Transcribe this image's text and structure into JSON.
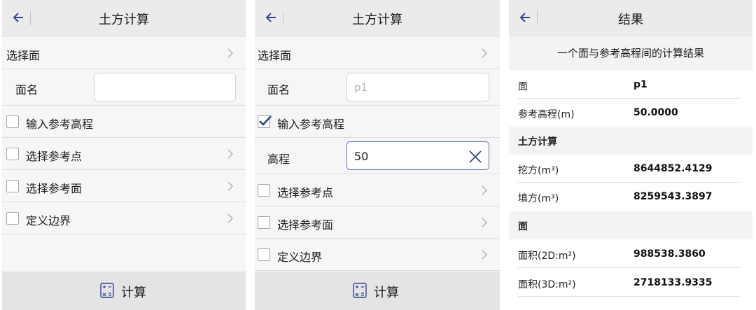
{
  "colors": {
    "accent": "#33458d",
    "header_bg": "#ebebeb",
    "footer_bg": "#e4e4e4"
  },
  "screens": [
    {
      "title": "土方计算",
      "select_surface": "选择面",
      "surface_name_label": "面名",
      "surface_name_value": "",
      "input_ref_elev": "输入参考高程",
      "input_ref_elev_checked": false,
      "select_ref_point": "选择参考点",
      "select_ref_surface": "选择参考面",
      "define_boundary": "定义边界",
      "calculate": "计算"
    },
    {
      "title": "土方计算",
      "select_surface": "选择面",
      "surface_name_label": "面名",
      "surface_name_placeholder": "p1",
      "input_ref_elev": "输入参考高程",
      "input_ref_elev_checked": true,
      "elevation_label": "高程",
      "elevation_value": "50",
      "select_ref_point": "选择参考点",
      "select_ref_surface": "选择参考面",
      "define_boundary": "定义边界",
      "calculate": "计算"
    },
    {
      "title": "结果",
      "subtitle": "一个面与参考高程间的计算结果",
      "rows": [
        {
          "key": "面",
          "value": "p1"
        },
        {
          "key": "参考高程(m)",
          "value": "50.0000"
        }
      ],
      "section_earthwork": "土方计算",
      "earthwork_rows": [
        {
          "key": "挖方(m³)",
          "value": "8644852.4129"
        },
        {
          "key": "填方(m³)",
          "value": "8259543.3897"
        }
      ],
      "section_surface": "面",
      "surface_rows": [
        {
          "key": "面积(2D:m²)",
          "value": "988538.3860"
        },
        {
          "key": "面积(3D:m²)",
          "value": "2718133.9335"
        }
      ]
    }
  ],
  "icons": [
    "back-arrow-icon",
    "chevron-right-icon",
    "checkbox-icon",
    "clear-icon",
    "calculator-icon"
  ]
}
